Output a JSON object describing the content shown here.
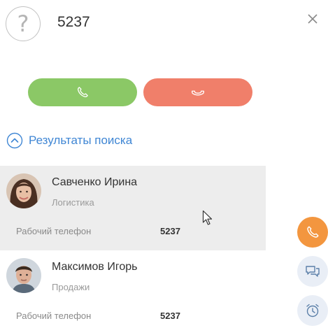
{
  "call": {
    "unknown_glyph": "?",
    "number": "5237",
    "close_icon": "close-icon",
    "answer_icon": "phone-icon",
    "reject_icon": "phone-hangup-icon",
    "answer_color": "#8bc866",
    "reject_color": "#f07f6a"
  },
  "results": {
    "header": "Результаты поиска",
    "accent": "#3f86d4"
  },
  "contacts": [
    {
      "name": "Савченко Ирина",
      "department": "Логистика",
      "phone_label": "Рабочий телефон",
      "phone": "5237"
    },
    {
      "name": "Максимов Игорь",
      "department": "Продажи",
      "phone_label": "Рабочий телефон",
      "phone": "5237"
    }
  ],
  "side_panel": {
    "phone_icon": "phone-icon",
    "chat_icon": "chat-icon",
    "clock_icon": "alarm-clock-icon",
    "phone_color": "#f3963f"
  }
}
